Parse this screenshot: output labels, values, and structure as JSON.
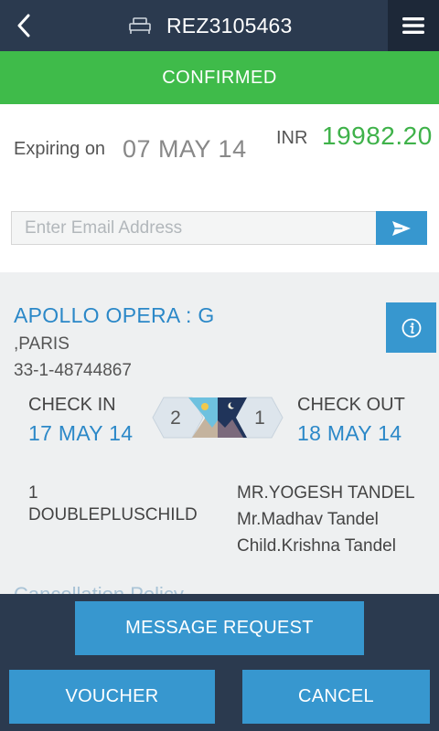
{
  "header": {
    "title": "REZ3105463",
    "back_icon": "chevron-left-icon",
    "booking_icon": "bed-icon",
    "menu_icon": "hamburger-menu-icon"
  },
  "status": {
    "label": "CONFIRMED",
    "color": "#3fbb4a"
  },
  "summary": {
    "expiring_label": "Expiring on",
    "expiring_date": "07 MAY 14",
    "currency": "INR",
    "amount": "19982.20"
  },
  "email": {
    "placeholder": "Enter Email Address",
    "value": "",
    "send_icon": "send-arrow-icon"
  },
  "hotel": {
    "name": "APOLLO OPERA : G",
    "city": ",PARIS",
    "phone": "33-1-48744867",
    "info_icon": "info-icon"
  },
  "stay": {
    "checkin_label": "CHECK IN",
    "checkin_date": "17 MAY 14",
    "checkout_label": "CHECK OUT",
    "checkout_date": "18 MAY 14",
    "adults": "2",
    "nights": "1"
  },
  "room": {
    "count": "1",
    "type": "DOUBLEPLUSCHILD"
  },
  "guests": [
    "MR.YOGESH TANDEL",
    "Mr.Madhav Tandel",
    "Child.Krishna Tandel"
  ],
  "policy": {
    "label": "Cancellation Policy"
  },
  "actions": {
    "message_request": "MESSAGE REQUEST",
    "voucher": "VOUCHER",
    "cancel": "CANCEL"
  },
  "colors": {
    "header_bg": "#2b3a4f",
    "accent_blue": "#3797cf",
    "amount_green": "#3fb24a",
    "link_blue": "#2b88c8"
  }
}
